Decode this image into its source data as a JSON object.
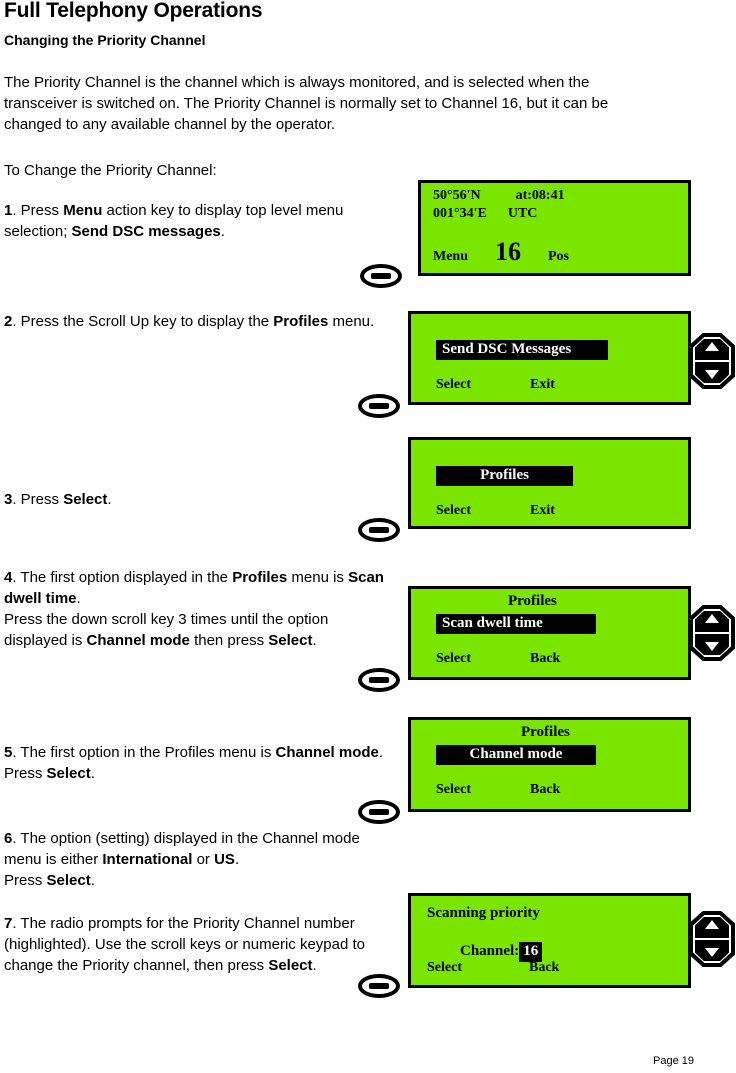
{
  "document": {
    "title": "Full Telephony Operations",
    "subtitle": "Changing the Priority Channel",
    "intro": "The Priority Channel is the channel which is always monitored, and is selected when the transceiver is switched on. The Priority Channel is normally set to Channel 16, but it can be changed to any available channel by the operator.",
    "lead": "To Change the Priority Channel:",
    "footer": "Page 19"
  },
  "steps": [
    {
      "number": "1",
      "text_parts": [
        {
          "t": ". Press ",
          "b": false
        },
        {
          "t": "Menu",
          "b": true
        },
        {
          "t": " action key to display top level menu selection; ",
          "b": false
        },
        {
          "t": "Send DSC messages",
          "b": true
        },
        {
          "t": ".",
          "b": false
        }
      ]
    },
    {
      "number": "2",
      "text_parts": [
        {
          "t": ". Press the Scroll Up key to display the ",
          "b": false
        },
        {
          "t": "Profiles",
          "b": true
        },
        {
          "t": " menu.",
          "b": false
        }
      ]
    },
    {
      "number": "3",
      "text_parts": [
        {
          "t": ". Press ",
          "b": false
        },
        {
          "t": "Select",
          "b": true
        },
        {
          "t": ".",
          "b": false
        }
      ]
    },
    {
      "number": "4",
      "text_parts": [
        {
          "t": ". The first option displayed in the ",
          "b": false
        },
        {
          "t": "Profiles",
          "b": true
        },
        {
          "t": " menu is ",
          "b": false
        },
        {
          "t": "Scan dwell time",
          "b": true
        },
        {
          "t": ".",
          "b": false
        },
        {
          "t": "\n",
          "b": false
        },
        {
          "t": "Press the down scroll key 3 times until the option displayed is ",
          "b": false
        },
        {
          "t": "Channel mode",
          "b": true
        },
        {
          "t": " then press ",
          "b": false
        },
        {
          "t": "Select",
          "b": true
        },
        {
          "t": ".",
          "b": false
        }
      ]
    },
    {
      "number": "5",
      "text_parts": [
        {
          "t": ". The first option in the Profiles menu is ",
          "b": false
        },
        {
          "t": "Channel mode",
          "b": true
        },
        {
          "t": ". Press ",
          "b": false
        },
        {
          "t": "Select",
          "b": true
        },
        {
          "t": ".",
          "b": false
        }
      ]
    },
    {
      "number": "6",
      "text_parts": [
        {
          "t": ". The option (setting) displayed in the Channel mode menu is either ",
          "b": false
        },
        {
          "t": "International",
          "b": true
        },
        {
          "t": " or ",
          "b": false
        },
        {
          "t": "US",
          "b": true
        },
        {
          "t": ".",
          "b": false
        },
        {
          "t": "\n",
          "b": false
        },
        {
          "t": "Press ",
          "b": false
        },
        {
          "t": "Select",
          "b": true
        },
        {
          "t": ".",
          "b": false
        }
      ]
    },
    {
      "number": "7",
      "text_parts": [
        {
          "t": ". The radio prompts for the Priority Channel number (highlighted). Use the scroll keys or numeric keypad to change the Priority channel, then press ",
          "b": false
        },
        {
          "t": "Select",
          "b": true
        },
        {
          "t": ".",
          "b": false
        }
      ]
    }
  ],
  "displays": [
    {
      "id": "home-screen",
      "latitude": "50°56'N",
      "time_label": "at:08:41",
      "longitude": "001°34'E",
      "time_zone": "UTC",
      "softkey_left": "Menu",
      "channel": "16",
      "softkey_right": "Pos"
    },
    {
      "id": "send-dsc-messages-menu",
      "selected_item": "Send DSC Messages",
      "softkey_left": "Select",
      "softkey_right": "Exit"
    },
    {
      "id": "profiles-menu",
      "selected_item": "Profiles",
      "softkey_left": "Select",
      "softkey_right": "Exit"
    },
    {
      "id": "profiles-scan-dwell-time",
      "header": "Profiles",
      "selected_item": "Scan dwell time",
      "softkey_left": "Select",
      "softkey_right": "Back"
    },
    {
      "id": "profiles-channel-mode",
      "header": "Profiles",
      "selected_item": "Channel mode",
      "softkey_left": "Select",
      "softkey_right": "Back"
    },
    {
      "id": "scanning-priority",
      "header": "Scanning priority",
      "field_label": "Channel:",
      "field_value": "16",
      "softkey_left": "Select",
      "softkey_right": "Back"
    }
  ],
  "colors": {
    "lcd_background": "#7ae600",
    "lcd_text": "#000000",
    "highlight_background": "#000000",
    "highlight_text": "#ffffff"
  },
  "icons": {
    "action_key": "action-key-icon",
    "scroll_key": "scroll-up-down-key-icon"
  }
}
